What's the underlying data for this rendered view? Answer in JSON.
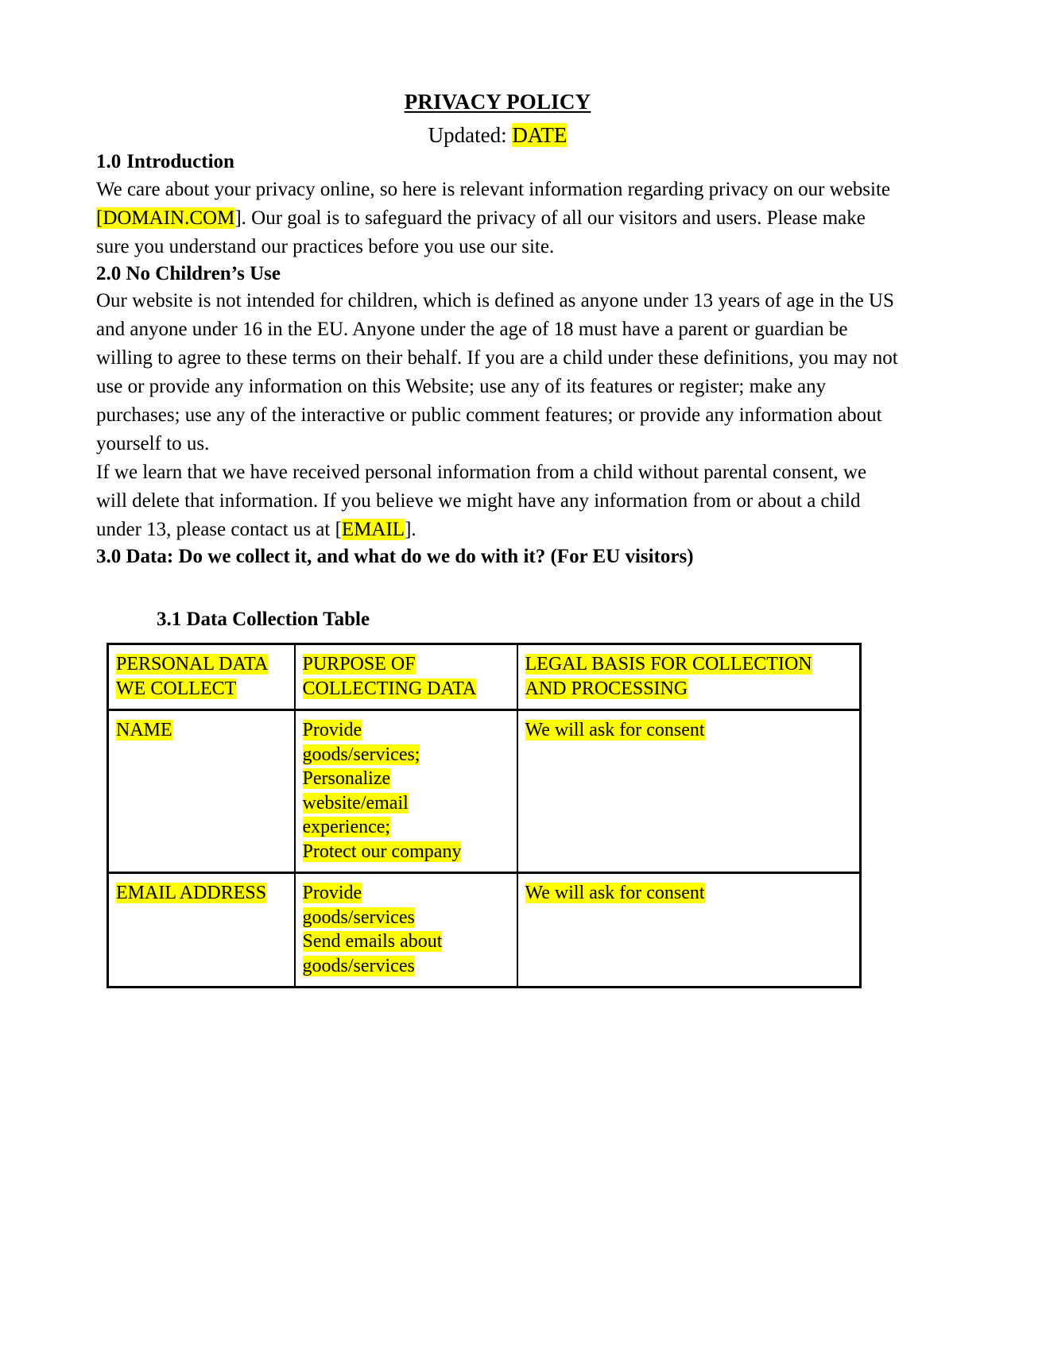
{
  "document": {
    "title": "PRIVACY POLICY",
    "updated_label": "Updated:",
    "updated_value": "DATE"
  },
  "sections": {
    "intro": {
      "number": "1.0",
      "heading": "Introduction",
      "paragraph_part1": "We care about your privacy online, so here is relevant information regarding privacy on our website ",
      "paragraph_highlight": "[DOMAIN.COM",
      "paragraph_part2": "]. Our goal is to safeguard the privacy of all our visitors and users. Please make sure you understand our practices before you use our site."
    },
    "children": {
      "heading": "2.0 No Children’s Use",
      "paragraph1": "Our website is not intended for children, which is defined as anyone under 13 years of age in the US and anyone under 16 in the EU. Anyone under the age of 18 must have a parent or guardian be willing to agree to these terms on their behalf. If you are a child under these definitions, you may not use or provide any information on this Website; use any of its features or register; make any purchases; use any of the interactive or public comment features; or provide any information about yourself to us.",
      "paragraph2_part1": "If we learn that we have received personal information from a child without parental consent, we will delete that information. If you believe we might have any information from or about a child under 13, please contact us at [",
      "paragraph2_highlight": "EMAIL",
      "paragraph2_part2": "]."
    },
    "data": {
      "heading": "3.0 Data: Do we collect it, and what do we do with it? (For EU visitors)",
      "subheading": "3.1 Data Collection Table"
    }
  },
  "table": {
    "headers": [
      [
        "PERSONAL DATA",
        "WE COLLECT"
      ],
      [
        "PURPOSE OF",
        "COLLECTING DATA"
      ],
      [
        "LEGAL BASIS FOR COLLECTION",
        "AND PROCESSING"
      ]
    ],
    "rows": [
      {
        "data": [
          "NAME"
        ],
        "purpose": [
          "Provide",
          "goods/services;",
          "Personalize",
          "website/email",
          "experience;",
          "Protect our company"
        ],
        "basis": [
          "We will ask for consent"
        ]
      },
      {
        "data": [
          "EMAIL ADDRESS"
        ],
        "purpose": [
          "Provide",
          "goods/services",
          "Send emails about",
          "goods/services"
        ],
        "basis": [
          "We will ask for consent"
        ]
      }
    ]
  },
  "colors": {
    "highlight": "#ffff00",
    "text": "#000000",
    "background": "#ffffff"
  }
}
